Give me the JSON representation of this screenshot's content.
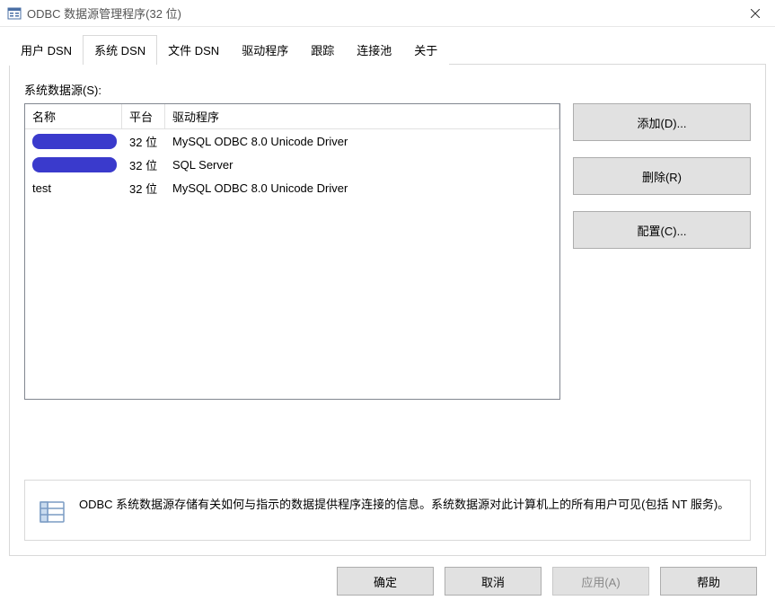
{
  "window": {
    "title": "ODBC 数据源管理程序(32 位)"
  },
  "tabs": [
    {
      "label": "用户 DSN"
    },
    {
      "label": "系统 DSN"
    },
    {
      "label": "文件 DSN"
    },
    {
      "label": "驱动程序"
    },
    {
      "label": "跟踪"
    },
    {
      "label": "连接池"
    },
    {
      "label": "关于"
    }
  ],
  "active_tab_index": 1,
  "section_label": "系统数据源(S):",
  "listview": {
    "headers": {
      "name": "名称",
      "platform": "平台",
      "driver": "驱动程序"
    },
    "rows": [
      {
        "name": "",
        "redacted": true,
        "platform": "32 位",
        "driver": "MySQL ODBC 8.0 Unicode Driver"
      },
      {
        "name": "",
        "redacted": true,
        "platform": "32 位",
        "driver": "SQL Server"
      },
      {
        "name": "test",
        "redacted": false,
        "platform": "32 位",
        "driver": "MySQL ODBC 8.0 Unicode Driver"
      }
    ]
  },
  "side_buttons": {
    "add": "添加(D)...",
    "remove": "删除(R)",
    "config": "配置(C)..."
  },
  "info_text": "ODBC 系统数据源存储有关如何与指示的数据提供程序连接的信息。系统数据源对此计算机上的所有用户可见(包括 NT 服务)。",
  "footer": {
    "ok": "确定",
    "cancel": "取消",
    "apply": "应用(A)",
    "help": "帮助"
  }
}
